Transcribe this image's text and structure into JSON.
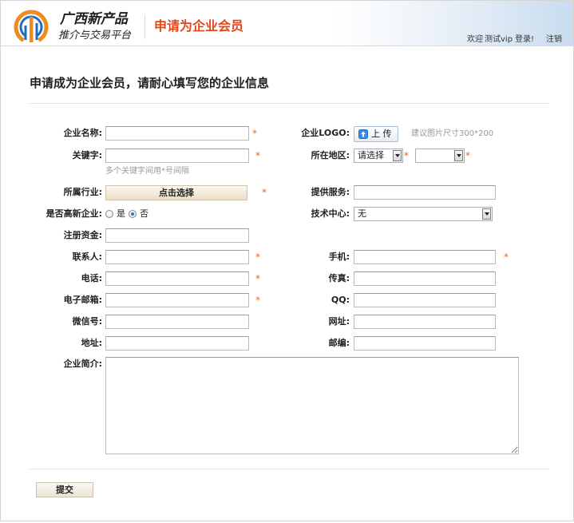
{
  "header": {
    "brand_name": "广西新产品",
    "brand_tagline": "推介与交易平台",
    "page_title": "申请为企业会员",
    "welcome": "欢迎",
    "username": "测试vip",
    "login": "登录!",
    "logout": "注销"
  },
  "form": {
    "title": "申请成为企业会员，请耐心填写您的企业信息",
    "required_mark": "*",
    "fields": {
      "company_name": {
        "label": "企业名称:",
        "value": "",
        "required": true
      },
      "keywords": {
        "label": "关键字:",
        "value": "",
        "required": true,
        "hint": "多个关键字间用*号间隔"
      },
      "industry": {
        "label": "所属行业:",
        "button_label": "点击选择",
        "required": true
      },
      "high_tech": {
        "label": "是否高新企业:",
        "options": [
          {
            "label": "是",
            "checked": false
          },
          {
            "label": "否",
            "checked": true
          }
        ]
      },
      "registered_capital": {
        "label": "注册资金:",
        "value": ""
      },
      "contact_person": {
        "label": "联系人:",
        "value": "",
        "required": true
      },
      "telephone": {
        "label": "电话:",
        "value": "",
        "required": true
      },
      "email": {
        "label": "电子邮箱:",
        "value": "",
        "required": true
      },
      "wechat": {
        "label": "微信号:",
        "value": ""
      },
      "address": {
        "label": "地址:",
        "value": ""
      },
      "introduction": {
        "label": "企业简介:",
        "value": ""
      },
      "logo": {
        "label": "企业LOGO:",
        "upload_label": "上 传",
        "hint": "建议图片尺寸300*200"
      },
      "region": {
        "label": "所在地区:",
        "province_selected": "请选择",
        "city_selected": "",
        "required": true
      },
      "services": {
        "label": "提供服务:",
        "value": ""
      },
      "tech_center": {
        "label": "技术中心:",
        "selected": "无"
      },
      "mobile": {
        "label": "手机:",
        "value": "",
        "required": true
      },
      "fax": {
        "label": "传真:",
        "value": ""
      },
      "qq": {
        "label": "QQ:",
        "value": ""
      },
      "website": {
        "label": "网址:",
        "value": ""
      },
      "postcode": {
        "label": "邮编:",
        "value": ""
      }
    },
    "submit_label": "提交"
  },
  "icons": {
    "brand_logo": "brand-logo",
    "upload": "upload-icon",
    "dropdown": "chevron-down-icon",
    "radio": "radio-button"
  },
  "colors": {
    "accent": "#e0481b",
    "required": "#f2631f",
    "divider": "#d6e6f1",
    "header_tint": "#c9dcef",
    "radio_checked": "#2a72d2",
    "logo_orange": "#f08c1e",
    "logo_blue": "#1f6cc0",
    "button_beige": "#e9dec6",
    "hint_text": "#999999",
    "upload_blue": "#3a8be0"
  }
}
